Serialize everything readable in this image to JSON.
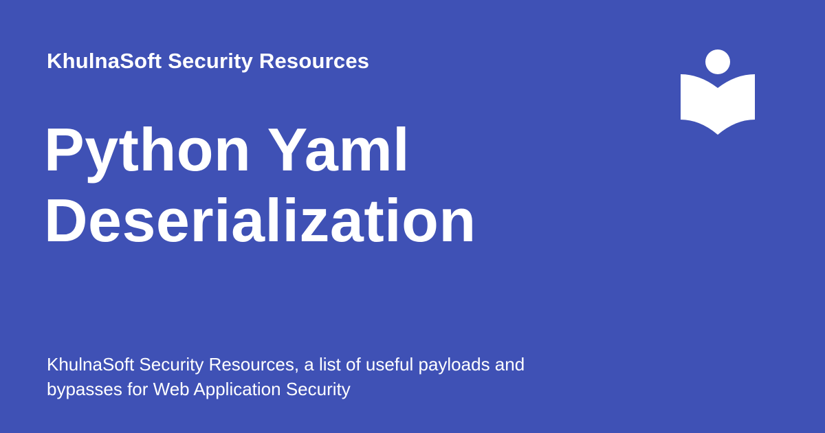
{
  "card": {
    "site_name": "KhulnaSoft Security Resources",
    "title_lines": [
      "Python Yaml",
      "Deserialization"
    ],
    "description": "KhulnaSoft Security Resources, a list of useful payloads and bypasses for Web Application Security",
    "logo_icon": "reader-book-icon",
    "colors": {
      "background": "#3f51b5",
      "text": "#ffffff"
    }
  }
}
